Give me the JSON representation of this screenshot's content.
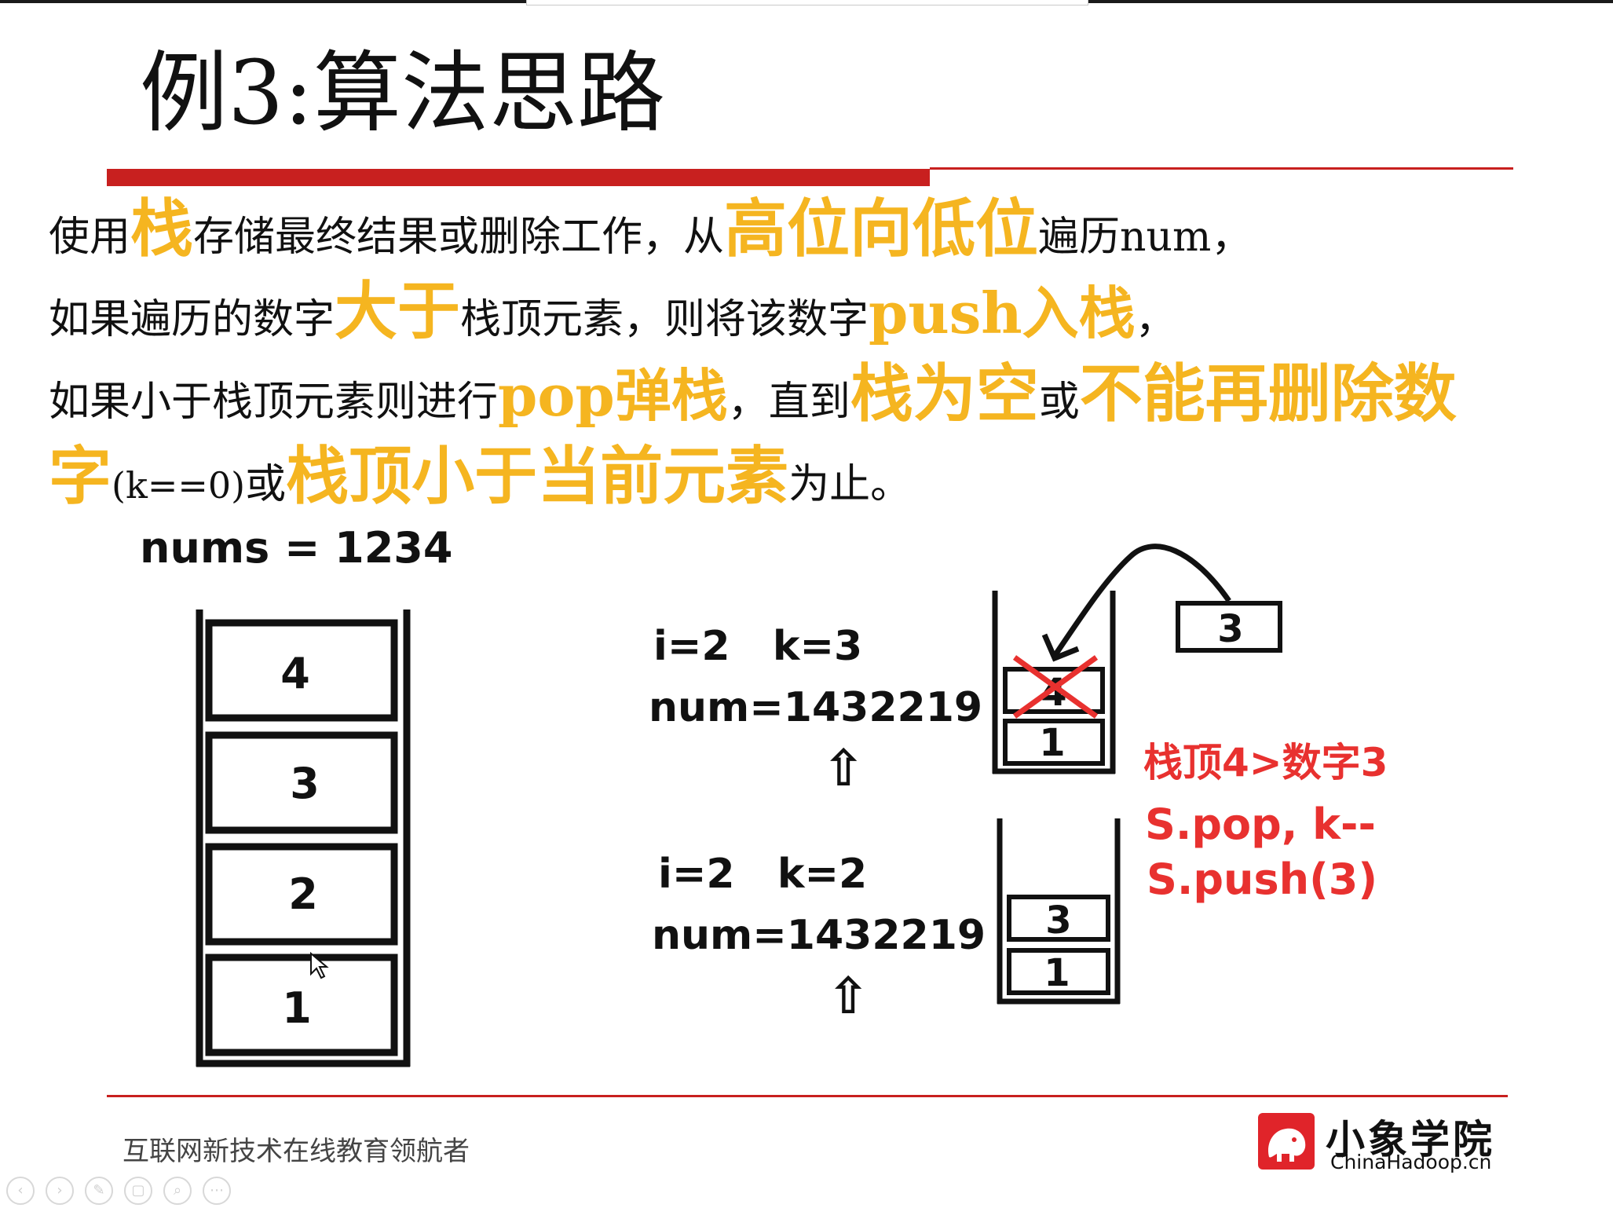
{
  "title": "例3:算法思路",
  "paragraph": {
    "line1": {
      "t1": "使用",
      "h1": "栈",
      "t2": "存储最终结果或删除工作，从",
      "h2": "高位向低位",
      "t3": "遍历num，"
    },
    "line2": {
      "t1": "如果遍历的数字",
      "h1": "大于",
      "t2": "栈顶元素，则将该数字",
      "h2": "push入栈",
      "t3": "，"
    },
    "line3": {
      "t1": "如果小于栈顶元素则进行",
      "h1": "pop弹栈",
      "t2": "，直到",
      "h2": "栈为空",
      "t3": "或",
      "h3": "不能再删除数"
    },
    "line4": {
      "h1": "字",
      "s1": "(k==0)",
      "t1": "或",
      "h2": "栈顶小于当前元素",
      "t2": "为止。"
    }
  },
  "left_stack": {
    "label": "nums = 1234",
    "cells": [
      "4",
      "3",
      "2",
      "1"
    ]
  },
  "step1": {
    "ik": "i=2   k=3",
    "num": "num=1432219",
    "arrow": "⇧",
    "stack_cells": [
      "4",
      "1"
    ],
    "incoming": "3",
    "crossed_cell": "4"
  },
  "step2": {
    "ik": "i=2   k=2",
    "num": "num=1432219",
    "arrow": "⇧",
    "stack_cells": [
      "3",
      "1"
    ]
  },
  "annotation": {
    "line1": "栈顶4>数字3",
    "line2": "S.pop, k--",
    "line3": "S.push(3)"
  },
  "footer": {
    "slogan": "互联网新技术在线教育领航者",
    "logo_cn": "小象学院",
    "logo_en": "ChinaHadoop.cn"
  },
  "colors": {
    "highlight": "#f5b520",
    "accent_red": "#c8201f",
    "annotation_red": "#e8312f"
  },
  "toolbar_icons": [
    "prev-icon",
    "next-icon",
    "pen-icon",
    "copy-icon",
    "zoom-icon",
    "more-icon"
  ]
}
